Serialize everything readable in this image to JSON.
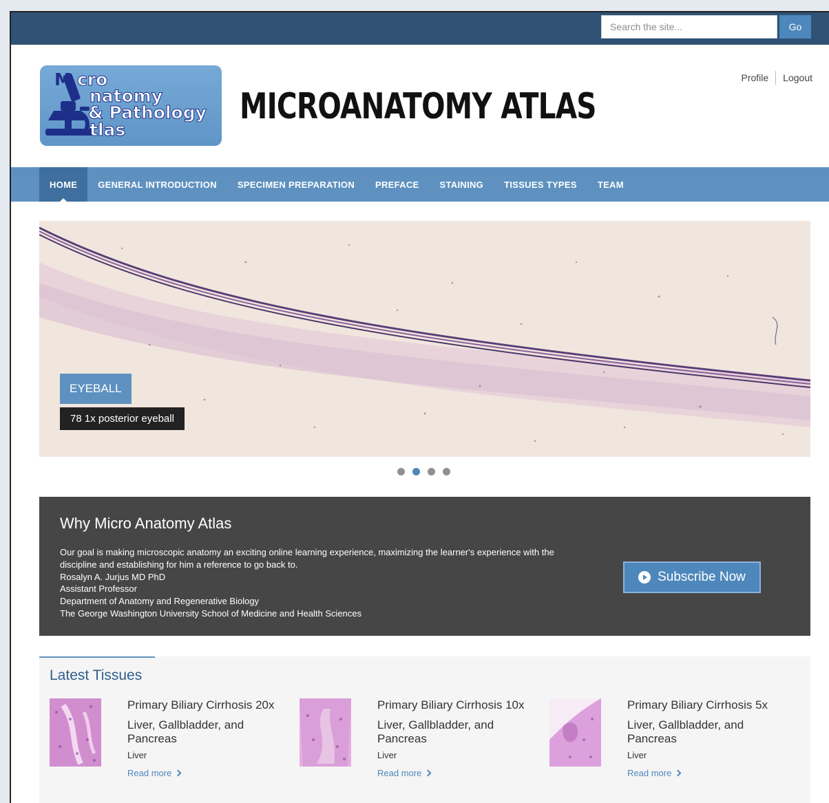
{
  "search": {
    "placeholder": "Search the site...",
    "go_label": "Go"
  },
  "header": {
    "logo_text": [
      "M",
      "cro",
      "natomy",
      "& Pathology",
      "tlas"
    ],
    "site_title": "MICROANATOMY ATLAS",
    "profile_label": "Profile",
    "logout_label": "Logout"
  },
  "nav": {
    "items": [
      {
        "label": "HOME",
        "active": true
      },
      {
        "label": "GENERAL INTRODUCTION"
      },
      {
        "label": "SPECIMEN PREPARATION"
      },
      {
        "label": "PREFACE"
      },
      {
        "label": "STAINING"
      },
      {
        "label": "TISSUES TYPES"
      },
      {
        "label": "TEAM"
      }
    ]
  },
  "slider": {
    "title": "EYEBALL",
    "caption": "78 1x posterior eyeball",
    "dot_count": 4,
    "active_dot": 2
  },
  "why": {
    "heading": "Why Micro Anatomy Atlas",
    "lines": [
      "Our goal is making microscopic anatomy an exciting online learning experience, maximizing the learner's experience with the discipline and establishing for him a reference to go back to.",
      "Rosalyn A. Jurjus MD PhD",
      "Assistant Professor",
      "Department of Anatomy and Regenerative Biology",
      "The George Washington University School of Medicine and Health Sciences"
    ],
    "subscribe_label": "Subscribe Now"
  },
  "latest": {
    "heading": "Latest Tissues",
    "items": [
      {
        "title": "Primary Biliary Cirrhosis 20x",
        "category": "Liver, Gallbladder, and Pancreas",
        "subcategory": "Liver",
        "more": "Read more"
      },
      {
        "title": "Primary Biliary Cirrhosis 10x",
        "category": "Liver, Gallbladder, and Pancreas",
        "subcategory": "Liver",
        "more": "Read more"
      },
      {
        "title": "Primary Biliary Cirrhosis 5x",
        "category": "Liver, Gallbladder, and Pancreas",
        "subcategory": "Liver",
        "more": "Read more"
      }
    ]
  },
  "colors": {
    "topbar": "#2f5275",
    "nav": "#5e91c0",
    "nav_active": "#3f6f9e",
    "accent": "#4e87bb",
    "panel": "#464646"
  }
}
